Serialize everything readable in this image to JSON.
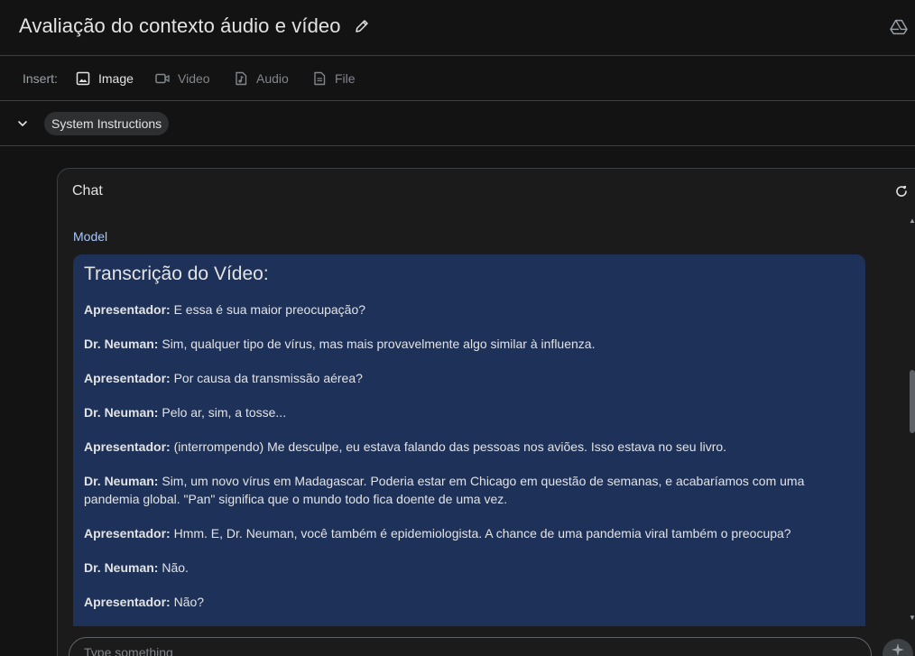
{
  "header": {
    "title": "Avaliação do contexto áudio e vídeo"
  },
  "insert_bar": {
    "label": "Insert:",
    "buttons": [
      {
        "label": "Image",
        "icon": "image-icon",
        "enabled": true
      },
      {
        "label": "Video",
        "icon": "video-icon",
        "enabled": false
      },
      {
        "label": "Audio",
        "icon": "audio-icon",
        "enabled": false
      },
      {
        "label": "File",
        "icon": "file-icon",
        "enabled": false
      }
    ]
  },
  "system": {
    "label": "System Instructions"
  },
  "chat": {
    "title": "Chat",
    "role_label": "Model",
    "heading": "Transcrição do Vídeo:",
    "lines": [
      {
        "speaker": "Apresentador:",
        "text": "E essa é sua maior preocupação?"
      },
      {
        "speaker": "Dr. Neuman:",
        "text": "Sim, qualquer tipo de vírus, mas mais provavelmente algo similar à influenza."
      },
      {
        "speaker": "Apresentador:",
        "text": "Por causa da transmissão aérea?"
      },
      {
        "speaker": "Dr. Neuman:",
        "text": "Pelo ar, sim, a tosse..."
      },
      {
        "speaker": "Apresentador:",
        "text": "(interrompendo) Me desculpe, eu estava falando das pessoas nos aviões. Isso estava no seu livro."
      },
      {
        "speaker": "Dr. Neuman:",
        "text": "Sim, um novo vírus em Madagascar. Poderia estar em Chicago em questão de semanas, e acabaríamos com uma pandemia global. \"Pan\" significa que o mundo todo fica doente de uma vez."
      },
      {
        "speaker": "Apresentador:",
        "text": "Hmm. E, Dr. Neuman, você também é epidemiologista. A chance de uma pandemia viral também o preocupa?"
      },
      {
        "speaker": "Dr. Neuman:",
        "text": "Não."
      },
      {
        "speaker": "Apresentador:",
        "text": "Não?"
      }
    ]
  },
  "input": {
    "placeholder": "Type something"
  },
  "colors": {
    "background": "#131314",
    "panel": "#1b1b1c",
    "message_bg": "#1e3158",
    "accent": "#a8c7fa"
  }
}
